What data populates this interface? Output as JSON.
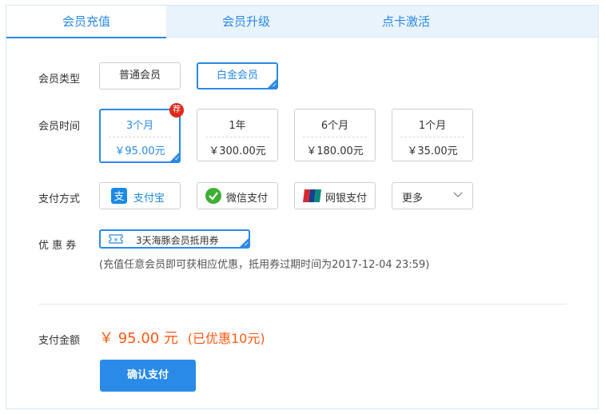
{
  "tabs": [
    {
      "label": "会员充值",
      "active": true
    },
    {
      "label": "会员升级",
      "active": false
    },
    {
      "label": "点卡激活",
      "active": false
    }
  ],
  "membership_type": {
    "label": "会员类型",
    "options": [
      {
        "label": "普通会员",
        "selected": false
      },
      {
        "label": "白金会员",
        "selected": true
      }
    ]
  },
  "membership_period": {
    "label": "会员时间",
    "options": [
      {
        "period": "3个月",
        "price": "￥95.00元",
        "selected": true,
        "badge": "荐"
      },
      {
        "period": "1年",
        "price": "￥300.00元",
        "selected": false
      },
      {
        "period": "6个月",
        "price": "￥180.00元",
        "selected": false
      },
      {
        "period": "1个月",
        "price": "￥35.00元",
        "selected": false
      }
    ]
  },
  "payment_method": {
    "label": "支付方式",
    "options": [
      {
        "label": "支付宝",
        "icon": "alipay-icon",
        "color": "#1a8ae6"
      },
      {
        "label": "微信支付",
        "icon": "wechat-icon",
        "color": "#3cb034"
      },
      {
        "label": "网银支付",
        "icon": "unionpay-icon",
        "color": "#d7282f"
      }
    ],
    "more": "更多"
  },
  "coupon": {
    "label": "优 惠 券",
    "selected": "3天海豚会员抵用券",
    "note": "(充值任意会员即可获相应优惠，抵用券过期时间为2017-12-04 23:59)"
  },
  "payment_amount": {
    "label": "支付金额",
    "amount": "￥ 95.00 元",
    "discount": "(已优惠10元)"
  },
  "confirm_label": "确认支付",
  "colors": {
    "accent": "#2a8ae8",
    "price": "#ff5a12",
    "badge": "#e0291a"
  }
}
